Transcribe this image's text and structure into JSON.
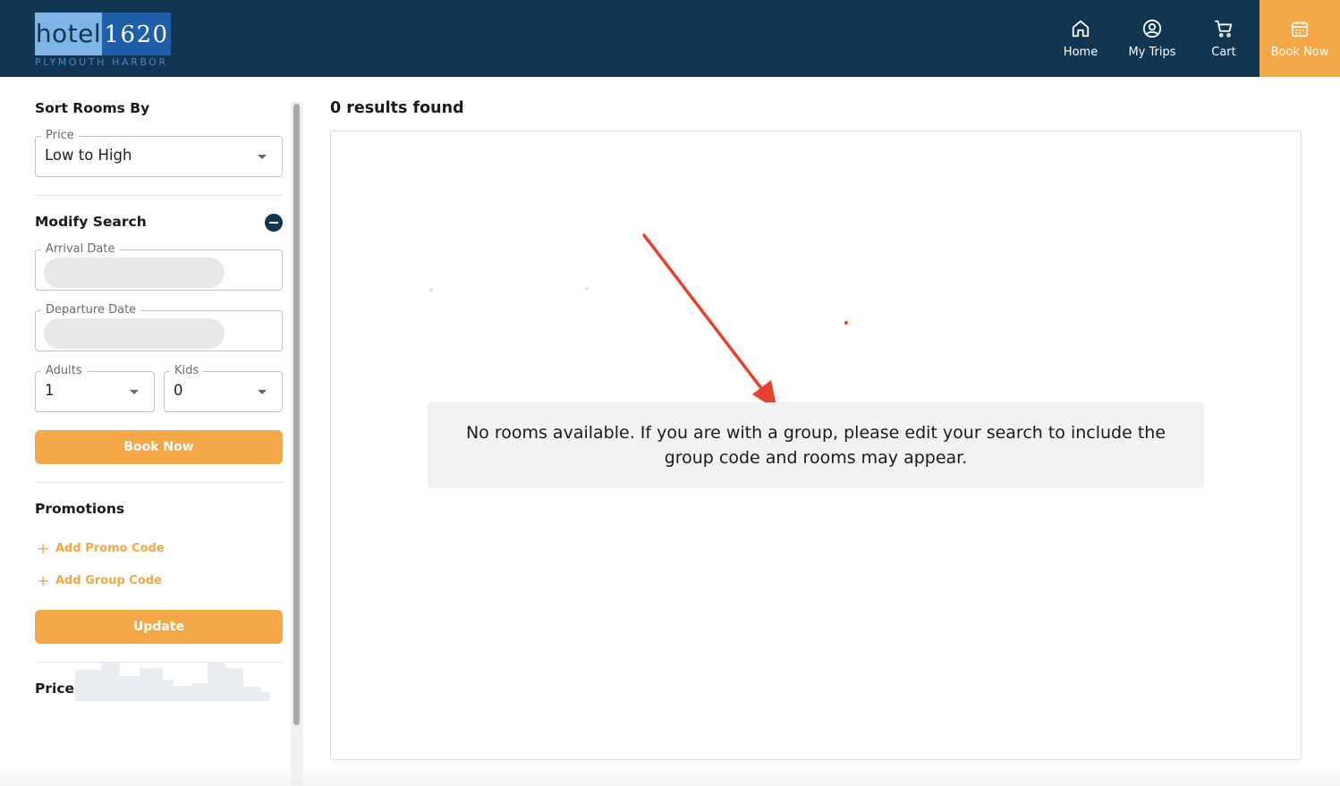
{
  "brand": {
    "logo_word": "hotel",
    "logo_number": "1620",
    "logo_subtitle": "PLYMOUTH HARBOR"
  },
  "nav": {
    "home": {
      "label": "Home",
      "icon": "home-icon"
    },
    "trips": {
      "label": "My Trips",
      "icon": "user-circle-icon"
    },
    "cart": {
      "label": "Cart",
      "icon": "cart-icon"
    },
    "book": {
      "label": "Book Now",
      "icon": "calendar-icon"
    }
  },
  "sidebar": {
    "sort": {
      "title": "Sort Rooms By",
      "field_label": "Price",
      "selected": "Low to High"
    },
    "modify": {
      "title": "Modify Search",
      "arrival_label": "Arrival Date",
      "arrival_value": "",
      "departure_label": "Departure Date",
      "departure_value": "",
      "adults_label": "Adults",
      "adults_value": "1",
      "kids_label": "Kids",
      "kids_value": "0",
      "book_button": "Book Now"
    },
    "promotions": {
      "title": "Promotions",
      "add_promo": "Add Promo Code",
      "add_group": "Add Group Code",
      "update_button": "Update"
    },
    "price": {
      "title": "Price"
    }
  },
  "main": {
    "results_count": "0 results found",
    "message": "No rooms available. If you are with a group, please edit your search to include the group code and rooms may appear."
  },
  "colors": {
    "header_bg": "#123552",
    "accent": "#f3a746",
    "annotation_arrow": "#e8412c"
  }
}
